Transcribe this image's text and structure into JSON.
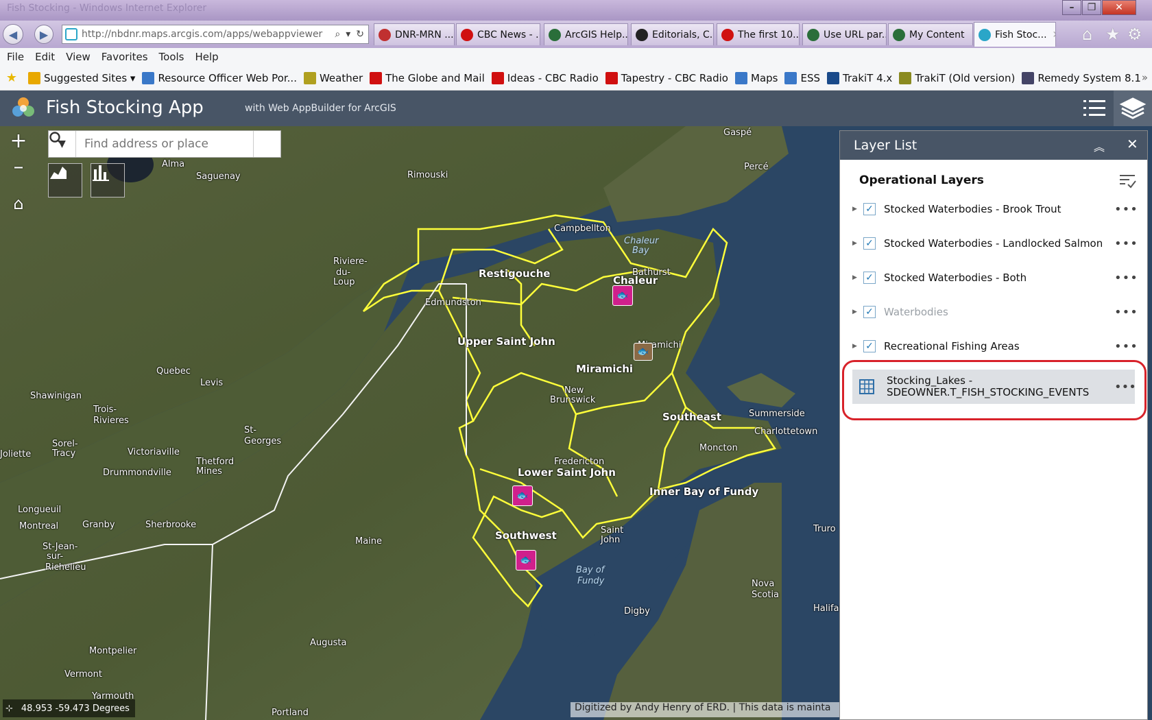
{
  "browser": {
    "window_title_ghost": "Fish Stocking - Windows Internet Explorer",
    "url": "http://nbdnr.maps.arcgis.com/apps/webappviewer",
    "tabs": [
      {
        "label": "DNR-MRN ...",
        "color": "#c03030",
        "icon": "dnr-icon"
      },
      {
        "label": "CBC News - ...",
        "color": "#d01010",
        "icon": "cbc-icon"
      },
      {
        "label": "ArcGIS Help...",
        "color": "#2a6e3a",
        "icon": "arcgis-icon"
      },
      {
        "label": "Editorials, C...",
        "color": "#222222",
        "icon": "nyt-icon"
      },
      {
        "label": "The first 10...",
        "color": "#d01010",
        "icon": "maple-leaf-icon"
      },
      {
        "label": "Use URL par...",
        "color": "#2a6e3a",
        "icon": "globe-icon"
      },
      {
        "label": "My Content",
        "color": "#2a6e3a",
        "icon": "globe-icon"
      },
      {
        "label": "Fish Stoc...",
        "color": "#2aa6c8",
        "icon": "webapp-icon"
      }
    ],
    "menu": [
      "File",
      "Edit",
      "View",
      "Favorites",
      "Tools",
      "Help"
    ],
    "favorites": [
      {
        "label": "Suggested Sites ▾",
        "icon": "bing-icon",
        "color": "#e8a800"
      },
      {
        "label": "Resource Officer Web Por...",
        "icon": "ie-page-icon",
        "color": "#3a78c8"
      },
      {
        "label": "Weather",
        "icon": "weather-icon",
        "color": "#b0a020"
      },
      {
        "label": "The Globe and Mail",
        "icon": "maple-leaf-icon",
        "color": "#d01010"
      },
      {
        "label": "Ideas - CBC Radio",
        "icon": "cbc-icon",
        "color": "#d01010"
      },
      {
        "label": "Tapestry - CBC Radio",
        "icon": "cbc-icon",
        "color": "#d01010"
      },
      {
        "label": "Maps",
        "icon": "ie-page-icon",
        "color": "#3a78c8"
      },
      {
        "label": "ESS",
        "icon": "ie-page-icon",
        "color": "#3a78c8"
      },
      {
        "label": "TrakiT 4.x",
        "icon": "trakit-icon",
        "color": "#1a4a8a"
      },
      {
        "label": "TrakiT (Old version)",
        "icon": "trakit-old-icon",
        "color": "#8a8a20"
      },
      {
        "label": "Remedy System 8.1",
        "icon": "remedy-icon",
        "color": "#444466"
      }
    ]
  },
  "app": {
    "title": "Fish Stocking App",
    "subtitle": "with Web AppBuilder for ArcGIS",
    "header_color": "#485566"
  },
  "map": {
    "search_placeholder": "Find address or place",
    "coordinates": "48.953 -59.473 Degrees",
    "attribution": "Digitized by Andy Henry of ERD. | This data is mainta",
    "region_labels": [
      "Restigouche",
      "Upper Saint John",
      "Miramichi",
      "Southeast",
      "Lower Saint John",
      "Inner Bay of Fundy",
      "Southwest",
      "Chaleur"
    ],
    "place_labels": [
      "Gaspé",
      "Percé",
      "Alma",
      "Saguenay",
      "Rimouski",
      "Campbellton",
      "Bathurst",
      "Riviere-",
      "du-",
      "Loup",
      "Edmundston",
      "Miramichi",
      "New",
      "Brunswick",
      "Quebec",
      "Levis",
      "Shawinigan",
      "Trois-",
      "Rivieres",
      "Sorel-",
      "Tracy",
      "Joliette",
      "Victoriaville",
      "Drummondville",
      "Thetford",
      "Mines",
      "St-",
      "Georges",
      "Longueuil",
      "Montreal",
      "Granby",
      "Sherbrooke",
      "St-Jean-",
      "sur-",
      "Richelieu",
      "Fredericton",
      "Maine",
      "Saint",
      "John",
      "Moncton",
      "Summerside",
      "Charlottetown",
      "Truro",
      "Nova",
      "Scotia",
      "Halifax",
      "Digby",
      "Augusta",
      "Montpelier",
      "Vermont",
      "Yarmouth",
      "Portland"
    ],
    "water_labels": [
      "Chaleur",
      "Bay",
      "Bay of",
      "Fundy"
    ]
  },
  "layer_list": {
    "title": "Layer List",
    "section": "Operational Layers",
    "layers": [
      {
        "name": "Stocked Waterbodies - Brook Trout",
        "checked": true,
        "dim": false
      },
      {
        "name": "Stocked Waterbodies - Landlocked Salmon",
        "checked": true,
        "dim": false
      },
      {
        "name": "Stocked Waterbodies - Both",
        "checked": true,
        "dim": false
      },
      {
        "name": "Waterbodies",
        "checked": true,
        "dim": true
      },
      {
        "name": "Recreational Fishing Areas",
        "checked": true,
        "dim": false
      }
    ],
    "table": {
      "line1": "Stocking_Lakes -",
      "line2": "SDEOWNER.T_FISH_STOCKING_EVENTS"
    },
    "highlight_color": "#d8222a"
  }
}
